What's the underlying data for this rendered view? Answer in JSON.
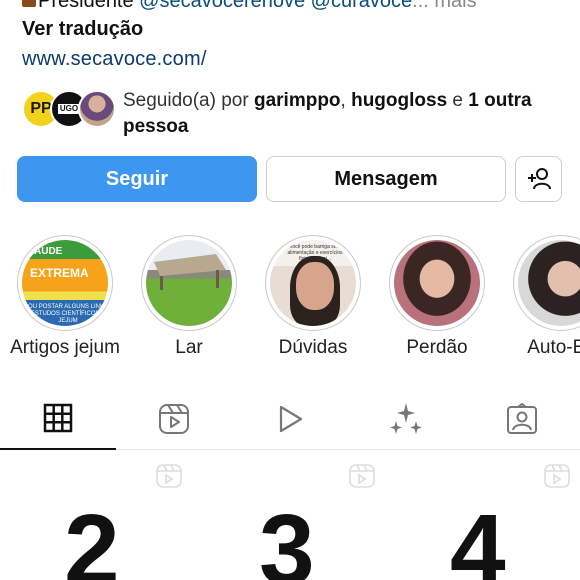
{
  "bio": {
    "line1_prefix": "Presidente ",
    "line1_tags": "@secavocerenove @curavoce",
    "line1_ellipsis": "...",
    "line1_more": "mais",
    "translate": "Ver tradução",
    "website": "www.secavoce.com/"
  },
  "followed_by": {
    "prefix": "Seguido(a) por ",
    "user1": "garimppo",
    "sep": ", ",
    "user2": "hugogloss",
    "and": " e ",
    "others": "1 outra pessoa",
    "avatar1_text": "PP",
    "avatar2_text": "UGO"
  },
  "buttons": {
    "follow": "Seguir",
    "message": "Mensagem"
  },
  "highlights": [
    {
      "label": "Artigos jejum",
      "img_t1": "AUDE",
      "img_t2": "EXTREMA",
      "img_t3": "OU POSTAR ALGUNS LINKS ESTUDOS CIENTÍFICOS E JEJUM"
    },
    {
      "label": "Lar"
    },
    {
      "label": "Dúvidas",
      "img_text": "Você pode barriga sem alimentação e exercícios físicos por si..."
    },
    {
      "label": "Perdão"
    },
    {
      "label": "Auto-Es"
    }
  ],
  "tabs": [
    {
      "icon": "grid-icon",
      "active": true
    },
    {
      "icon": "reels-icon",
      "active": false
    },
    {
      "icon": "play-icon",
      "active": false
    },
    {
      "icon": "sparkles-icon",
      "active": false
    },
    {
      "icon": "tagged-icon",
      "active": false
    }
  ],
  "grid": {
    "numbers": [
      "2",
      "3",
      "4"
    ]
  },
  "colors": {
    "follow_button": "#3d96f0",
    "link": "#0f3a6e"
  }
}
